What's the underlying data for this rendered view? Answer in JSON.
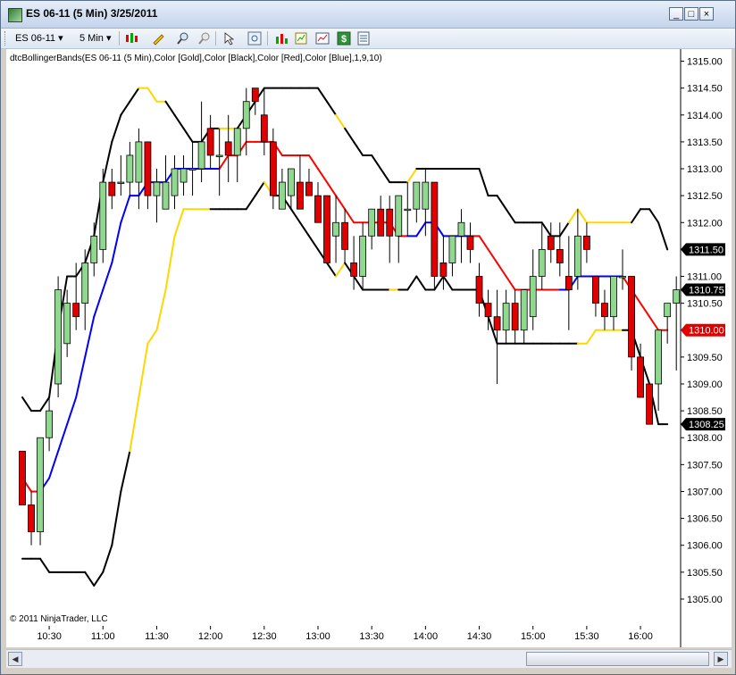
{
  "window": {
    "title": "ES 06-11 (5 Min)  3/25/2011",
    "minimize_label": "_",
    "maximize_label": "□",
    "close_label": "×"
  },
  "toolbar": {
    "instrument": "ES 06-11",
    "interval": "5 Min",
    "icons": [
      "bar-style-icon",
      "draw-pencil-icon",
      "zoom-in-icon",
      "zoom-out-icon",
      "cursor-icon",
      "magnify-icon",
      "indicators-icon",
      "strategies-icon",
      "chart-trader-icon",
      "dollar-icon",
      "properties-icon"
    ]
  },
  "colors": {
    "up_candle": "#90d890",
    "down_candle": "#e00000",
    "upper_band": "#000000",
    "upper_band_gold": "#ffd700",
    "lower_band": "#000000",
    "lower_band_gold": "#ffd700",
    "middle_red": "#ff0000",
    "middle_blue": "#0000ff"
  },
  "chart_data": {
    "type": "candlestick",
    "indicator_label": "dtcBollingerBands(ES 06-11 (5 Min),Color [Gold],Color [Black],Color [Red],Color [Blue],1,9,10)",
    "copyright": "© 2011 NinjaTrader, LLC",
    "ylim": [
      1304.85,
      1315.1
    ],
    "y_ticks": [
      "1315.00",
      "1314.50",
      "1314.00",
      "1313.50",
      "1313.00",
      "1312.50",
      "1312.00",
      "1311.50",
      "1311.00",
      "1310.50",
      "1310.00",
      "1309.50",
      "1309.00",
      "1308.50",
      "1308.00",
      "1307.50",
      "1307.00",
      "1306.50",
      "1306.00",
      "1305.50",
      "1305.00"
    ],
    "x_ticks": [
      "10:30",
      "11:00",
      "11:30",
      "12:00",
      "12:30",
      "13:00",
      "13:30",
      "14:00",
      "14:30",
      "15:00",
      "15:30",
      "16:00"
    ],
    "x_tick_bars": [
      3,
      9,
      15,
      21,
      27,
      33,
      39,
      45,
      51,
      57,
      63,
      69
    ],
    "price_markers": [
      {
        "label": "1311.50",
        "value": 1311.5,
        "style": "black"
      },
      {
        "label": "1310.75",
        "value": 1310.75,
        "style": "black"
      },
      {
        "label": "1310.00",
        "value": 1310.0,
        "style": "red"
      },
      {
        "label": "1308.25",
        "value": 1308.25,
        "style": "black"
      }
    ],
    "candles": [
      {
        "o": 1307.75,
        "h": 1307.75,
        "l": 1306.75,
        "c": 1306.75
      },
      {
        "o": 1306.75,
        "h": 1307.0,
        "l": 1306.0,
        "c": 1306.25
      },
      {
        "o": 1306.25,
        "h": 1308.0,
        "l": 1306.0,
        "c": 1308.0
      },
      {
        "o": 1308.0,
        "h": 1308.75,
        "l": 1307.75,
        "c": 1308.5
      },
      {
        "o": 1309.0,
        "h": 1311.0,
        "l": 1308.75,
        "c": 1310.75
      },
      {
        "o": 1309.75,
        "h": 1310.75,
        "l": 1309.5,
        "c": 1310.5
      },
      {
        "o": 1310.5,
        "h": 1311.25,
        "l": 1310.0,
        "c": 1310.25
      },
      {
        "o": 1310.5,
        "h": 1311.5,
        "l": 1310.0,
        "c": 1311.25
      },
      {
        "o": 1311.25,
        "h": 1312.0,
        "l": 1311.0,
        "c": 1311.75
      },
      {
        "o": 1311.5,
        "h": 1313.0,
        "l": 1311.25,
        "c": 1312.75
      },
      {
        "o": 1312.75,
        "h": 1313.0,
        "l": 1312.25,
        "c": 1312.5
      },
      {
        "o": 1312.75,
        "h": 1313.25,
        "l": 1312.5,
        "c": 1312.75
      },
      {
        "o": 1312.75,
        "h": 1313.5,
        "l": 1312.5,
        "c": 1313.25
      },
      {
        "o": 1312.75,
        "h": 1313.75,
        "l": 1312.25,
        "c": 1313.5
      },
      {
        "o": 1313.5,
        "h": 1313.5,
        "l": 1312.25,
        "c": 1312.5
      },
      {
        "o": 1312.5,
        "h": 1313.0,
        "l": 1312.0,
        "c": 1312.75
      },
      {
        "o": 1312.25,
        "h": 1313.25,
        "l": 1312.25,
        "c": 1312.75
      },
      {
        "o": 1312.5,
        "h": 1313.25,
        "l": 1312.25,
        "c": 1313.0
      },
      {
        "o": 1312.75,
        "h": 1313.25,
        "l": 1312.5,
        "c": 1313.0
      },
      {
        "o": 1313.0,
        "h": 1313.5,
        "l": 1312.5,
        "c": 1313.0
      },
      {
        "o": 1313.0,
        "h": 1314.25,
        "l": 1312.75,
        "c": 1313.5
      },
      {
        "o": 1313.75,
        "h": 1314.0,
        "l": 1313.0,
        "c": 1313.25
      },
      {
        "o": 1313.25,
        "h": 1313.75,
        "l": 1312.5,
        "c": 1313.25
      },
      {
        "o": 1313.5,
        "h": 1314.0,
        "l": 1312.75,
        "c": 1313.25
      },
      {
        "o": 1313.25,
        "h": 1313.75,
        "l": 1312.75,
        "c": 1313.75
      },
      {
        "o": 1313.75,
        "h": 1314.5,
        "l": 1313.25,
        "c": 1314.25
      },
      {
        "o": 1314.5,
        "h": 1314.5,
        "l": 1314.0,
        "c": 1314.25
      },
      {
        "o": 1314.0,
        "h": 1314.5,
        "l": 1313.25,
        "c": 1313.5
      },
      {
        "o": 1313.5,
        "h": 1313.75,
        "l": 1312.25,
        "c": 1312.5
      },
      {
        "o": 1312.25,
        "h": 1313.0,
        "l": 1312.25,
        "c": 1312.75
      },
      {
        "o": 1312.5,
        "h": 1313.0,
        "l": 1312.25,
        "c": 1313.0
      },
      {
        "o": 1312.75,
        "h": 1313.25,
        "l": 1312.25,
        "c": 1312.25
      },
      {
        "o": 1312.75,
        "h": 1313.0,
        "l": 1312.5,
        "c": 1312.5
      },
      {
        "o": 1312.5,
        "h": 1312.75,
        "l": 1312.0,
        "c": 1312.0
      },
      {
        "o": 1312.5,
        "h": 1312.5,
        "l": 1311.25,
        "c": 1311.25
      },
      {
        "o": 1311.75,
        "h": 1312.5,
        "l": 1311.25,
        "c": 1312.0
      },
      {
        "o": 1312.0,
        "h": 1312.25,
        "l": 1311.25,
        "c": 1311.5
      },
      {
        "o": 1311.25,
        "h": 1311.75,
        "l": 1310.75,
        "c": 1311.0
      },
      {
        "o": 1311.0,
        "h": 1312.0,
        "l": 1310.75,
        "c": 1311.75
      },
      {
        "o": 1311.75,
        "h": 1312.25,
        "l": 1311.5,
        "c": 1312.25
      },
      {
        "o": 1312.25,
        "h": 1312.5,
        "l": 1311.75,
        "c": 1311.75
      },
      {
        "o": 1312.25,
        "h": 1312.5,
        "l": 1311.25,
        "c": 1311.75
      },
      {
        "o": 1311.75,
        "h": 1312.5,
        "l": 1311.25,
        "c": 1312.5
      },
      {
        "o": 1312.25,
        "h": 1312.75,
        "l": 1311.75,
        "c": 1312.25
      },
      {
        "o": 1312.25,
        "h": 1312.75,
        "l": 1312.0,
        "c": 1312.75
      },
      {
        "o": 1312.25,
        "h": 1313.0,
        "l": 1311.75,
        "c": 1312.75
      },
      {
        "o": 1312.75,
        "h": 1312.75,
        "l": 1310.75,
        "c": 1311.0
      },
      {
        "o": 1311.25,
        "h": 1311.75,
        "l": 1310.75,
        "c": 1311.0
      },
      {
        "o": 1311.25,
        "h": 1311.75,
        "l": 1311.0,
        "c": 1311.75
      },
      {
        "o": 1311.75,
        "h": 1312.25,
        "l": 1311.25,
        "c": 1312.0
      },
      {
        "o": 1311.75,
        "h": 1312.0,
        "l": 1311.25,
        "c": 1311.5
      },
      {
        "o": 1311.0,
        "h": 1311.25,
        "l": 1310.25,
        "c": 1310.5
      },
      {
        "o": 1310.5,
        "h": 1310.75,
        "l": 1310.0,
        "c": 1310.25
      },
      {
        "o": 1310.25,
        "h": 1310.75,
        "l": 1309.0,
        "c": 1310.0
      },
      {
        "o": 1310.0,
        "h": 1310.75,
        "l": 1309.75,
        "c": 1310.5
      },
      {
        "o": 1310.5,
        "h": 1310.75,
        "l": 1309.75,
        "c": 1310.0
      },
      {
        "o": 1310.0,
        "h": 1310.75,
        "l": 1309.75,
        "c": 1310.75
      },
      {
        "o": 1310.25,
        "h": 1311.5,
        "l": 1310.0,
        "c": 1311.0
      },
      {
        "o": 1311.0,
        "h": 1312.0,
        "l": 1310.75,
        "c": 1311.5
      },
      {
        "o": 1311.75,
        "h": 1312.0,
        "l": 1311.25,
        "c": 1311.5
      },
      {
        "o": 1311.5,
        "h": 1312.0,
        "l": 1311.0,
        "c": 1311.25
      },
      {
        "o": 1311.0,
        "h": 1311.75,
        "l": 1310.0,
        "c": 1310.75
      },
      {
        "o": 1311.0,
        "h": 1312.25,
        "l": 1310.75,
        "c": 1311.75
      },
      {
        "o": 1311.75,
        "h": 1312.0,
        "l": 1311.25,
        "c": 1311.5
      },
      {
        "o": 1311.0,
        "h": 1311.0,
        "l": 1310.25,
        "c": 1310.5
      },
      {
        "o": 1310.5,
        "h": 1310.75,
        "l": 1310.0,
        "c": 1310.25
      },
      {
        "o": 1310.25,
        "h": 1311.0,
        "l": 1310.0,
        "c": 1311.0
      },
      {
        "o": 1311.0,
        "h": 1311.5,
        "l": 1310.75,
        "c": 1311.0
      },
      {
        "o": 1311.0,
        "h": 1311.0,
        "l": 1309.25,
        "c": 1309.5
      },
      {
        "o": 1309.5,
        "h": 1309.75,
        "l": 1308.75,
        "c": 1308.75
      },
      {
        "o": 1309.0,
        "h": 1309.0,
        "l": 1308.25,
        "c": 1308.25
      },
      {
        "o": 1309.0,
        "h": 1310.0,
        "l": 1308.5,
        "c": 1310.0
      },
      {
        "o": 1310.25,
        "h": 1310.5,
        "l": 1309.75,
        "c": 1310.5
      },
      {
        "o": 1310.5,
        "h": 1311.0,
        "l": 1309.25,
        "c": 1310.75
      }
    ],
    "upper_band": {
      "values": [
        1308.75,
        1308.5,
        1308.5,
        1308.75,
        1310.0,
        1311.0,
        1311.0,
        1311.25,
        1311.75,
        1312.75,
        1313.5,
        1314.0,
        1314.25,
        1314.5,
        1314.5,
        1314.25,
        1314.25,
        1314.0,
        1313.75,
        1313.5,
        1313.5,
        1313.75,
        1313.75,
        1313.75,
        1313.75,
        1314.0,
        1314.25,
        1314.5,
        1314.5,
        1314.5,
        1314.5,
        1314.5,
        1314.5,
        1314.5,
        1314.25,
        1314.0,
        1313.75,
        1313.5,
        1313.25,
        1313.25,
        1313.0,
        1312.75,
        1312.75,
        1312.75,
        1313.0,
        1313.0,
        1313.0,
        1313.0,
        1313.0,
        1313.0,
        1313.0,
        1313.0,
        1312.5,
        1312.5,
        1312.25,
        1312.0,
        1312.0,
        1312.0,
        1312.0,
        1311.75,
        1311.75,
        1312.0,
        1312.25,
        1312.0,
        1312.0,
        1312.0,
        1312.0,
        1312.0,
        1312.0,
        1312.25,
        1312.25,
        1312.0,
        1311.5
      ],
      "gold_ranges": [
        [
          13,
          16
        ],
        [
          22,
          24
        ],
        [
          35,
          36
        ],
        [
          43,
          44
        ],
        [
          61,
          68
        ]
      ]
    },
    "lower_band": {
      "values": [
        1305.75,
        1305.75,
        1305.75,
        1305.5,
        1305.5,
        1305.5,
        1305.5,
        1305.5,
        1305.25,
        1305.5,
        1306.0,
        1307.0,
        1307.75,
        1308.75,
        1309.75,
        1310.0,
        1310.75,
        1311.75,
        1312.25,
        1312.25,
        1312.25,
        1312.25,
        1312.25,
        1312.25,
        1312.25,
        1312.25,
        1312.5,
        1312.75,
        1312.5,
        1312.5,
        1312.25,
        1312.0,
        1311.75,
        1311.5,
        1311.25,
        1311.0,
        1311.25,
        1311.0,
        1310.75,
        1310.75,
        1310.75,
        1310.75,
        1310.75,
        1310.75,
        1311.0,
        1310.75,
        1310.75,
        1311.0,
        1310.75,
        1310.75,
        1310.75,
        1310.75,
        1310.25,
        1309.75,
        1309.75,
        1309.75,
        1309.75,
        1309.75,
        1309.75,
        1309.75,
        1309.75,
        1309.75,
        1309.75,
        1309.75,
        1310.0,
        1310.0,
        1310.0,
        1310.0,
        1310.0,
        1309.5,
        1309.0,
        1308.25,
        1308.25
      ],
      "gold_ranges": [
        [
          12,
          21
        ],
        [
          27,
          28
        ],
        [
          35,
          36
        ],
        [
          41,
          42
        ],
        [
          62,
          67
        ]
      ]
    },
    "middle_band": {
      "values": [
        1307.25,
        1307.0,
        1307.0,
        1307.25,
        1307.75,
        1308.25,
        1308.75,
        1309.5,
        1310.25,
        1310.75,
        1311.25,
        1312.0,
        1312.5,
        1312.5,
        1312.75,
        1312.75,
        1312.75,
        1313.0,
        1313.0,
        1313.0,
        1313.0,
        1313.0,
        1313.0,
        1313.25,
        1313.25,
        1313.5,
        1313.5,
        1313.5,
        1313.5,
        1313.25,
        1313.25,
        1313.25,
        1313.25,
        1313.0,
        1312.75,
        1312.5,
        1312.25,
        1312.0,
        1312.0,
        1312.0,
        1312.0,
        1312.0,
        1311.75,
        1311.75,
        1311.75,
        1312.0,
        1312.0,
        1311.75,
        1311.75,
        1311.75,
        1311.75,
        1311.75,
        1311.5,
        1311.25,
        1311.0,
        1310.75,
        1310.75,
        1310.75,
        1310.75,
        1310.75,
        1310.75,
        1310.75,
        1311.0,
        1311.0,
        1311.0,
        1311.0,
        1311.0,
        1311.0,
        1310.75,
        1310.5,
        1310.25,
        1310.0,
        1310.0
      ],
      "red_ranges": [
        [
          0,
          2
        ],
        [
          22,
          43
        ],
        [
          50,
          60
        ],
        [
          67,
          72
        ]
      ]
    }
  }
}
